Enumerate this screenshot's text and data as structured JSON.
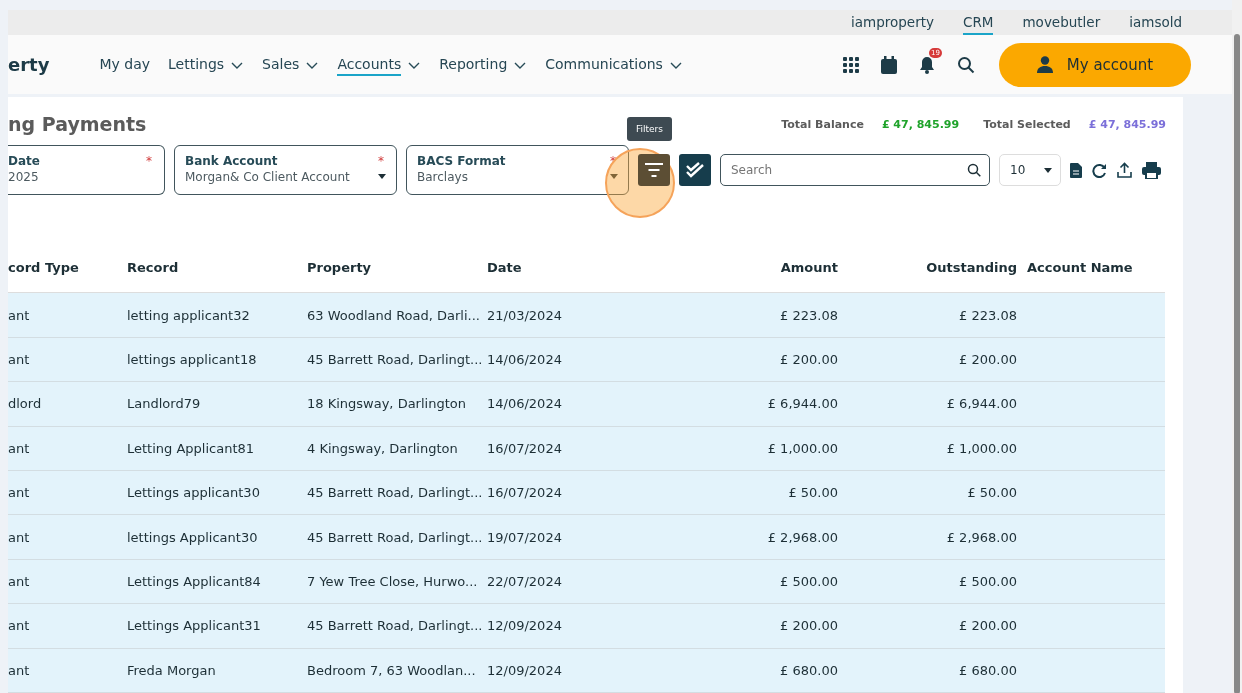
{
  "sites": [
    {
      "label": "iamproperty",
      "selected": false
    },
    {
      "label": "CRM",
      "selected": true
    },
    {
      "label": "movebutler",
      "selected": false
    },
    {
      "label": "iamsold",
      "selected": false
    }
  ],
  "brand": "erty",
  "nav": [
    {
      "label": "My day",
      "selected": false,
      "has_menu": false
    },
    {
      "label": "Lettings",
      "selected": false,
      "has_menu": true
    },
    {
      "label": "Sales",
      "selected": false,
      "has_menu": true
    },
    {
      "label": "Accounts",
      "selected": true,
      "has_menu": true
    },
    {
      "label": "Reporting",
      "selected": false,
      "has_menu": true
    },
    {
      "label": "Communications",
      "selected": false,
      "has_menu": true
    }
  ],
  "notifications_badge": "19",
  "account_button": "My account",
  "page_title": "ng Payments",
  "totals": [
    {
      "label": "Total Balance",
      "value": "£ 47, 845.99",
      "color": "#1fa32a"
    },
    {
      "label": "Total Selected",
      "value": "£ 47, 845.99",
      "color": "#7b6fd9"
    }
  ],
  "filters": [
    {
      "label": "Date",
      "value": "2025",
      "required_mark": "*",
      "kind": "date"
    },
    {
      "label": "Bank Account",
      "value": "Morgan& Co Client Account",
      "required_mark": "*",
      "kind": "dropdown"
    },
    {
      "label": "BACS Format",
      "value": "Barclays",
      "required_mark": "*",
      "kind": "dropdown"
    }
  ],
  "filters_tooltip": "Filters",
  "search": {
    "placeholder": "Search"
  },
  "page_size": "10",
  "table": {
    "columns": [
      "cord Type",
      "Record",
      "Property",
      "Date",
      "Amount",
      "Outstanding",
      "Account Name"
    ],
    "rows": [
      {
        "selected": true,
        "cells": [
          "ant",
          "letting applicant32",
          "63 Woodland Road, Darli...",
          "21/03/2024",
          "£ 223.08",
          "£ 223.08",
          ""
        ]
      },
      {
        "selected": true,
        "cells": [
          "ant",
          "lettings applicant18",
          "45 Barrett Road, Darlingt...",
          "14/06/2024",
          "£ 200.00",
          "£ 200.00",
          ""
        ]
      },
      {
        "selected": true,
        "cells": [
          "dlord",
          "Landlord79",
          "18 Kingsway, Darlington",
          "14/06/2024",
          "£ 6,944.00",
          "£ 6,944.00",
          ""
        ]
      },
      {
        "selected": true,
        "cells": [
          "ant",
          "Letting Applicant81",
          "4 Kingsway, Darlington",
          "16/07/2024",
          "£ 1,000.00",
          "£ 1,000.00",
          ""
        ]
      },
      {
        "selected": true,
        "cells": [
          "ant",
          "Lettings applicant30",
          "45 Barrett Road, Darlingt...",
          "16/07/2024",
          "£ 50.00",
          "£ 50.00",
          ""
        ]
      },
      {
        "selected": true,
        "cells": [
          "ant",
          "lettings Applicant30",
          "45 Barrett Road, Darlingt...",
          "19/07/2024",
          "£ 2,968.00",
          "£ 2,968.00",
          ""
        ]
      },
      {
        "selected": true,
        "cells": [
          "ant",
          "Lettings Applicant84",
          "7 Yew Tree Close, Hurwo...",
          "22/07/2024",
          "£ 500.00",
          "£ 500.00",
          ""
        ]
      },
      {
        "selected": true,
        "cells": [
          "ant",
          "Lettings Applicant31",
          "45 Barrett Road, Darlingt...",
          "12/09/2024",
          "£ 200.00",
          "£ 200.00",
          ""
        ]
      },
      {
        "selected": true,
        "cells": [
          "ant",
          "Freda Morgan",
          "Bedroom 7, 63 Woodlan...",
          "12/09/2024",
          "£ 680.00",
          "£ 680.00",
          ""
        ]
      }
    ]
  }
}
